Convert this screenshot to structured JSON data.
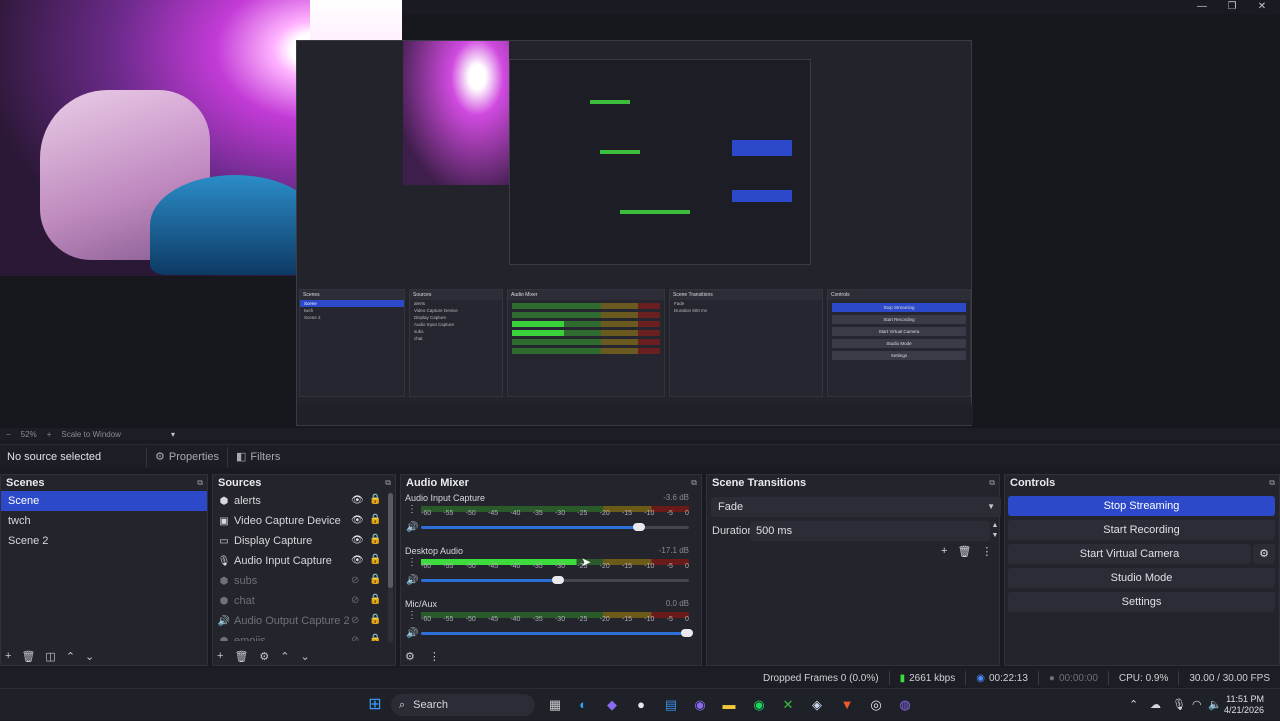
{
  "window": {
    "minimize": "—",
    "maximize": "❐",
    "close": "✕"
  },
  "zoom": {
    "percent": "52%",
    "plus": "+",
    "scale_mode": "Scale to Window",
    "dropdown": "▾"
  },
  "source_toolbar": {
    "no_source": "No source selected",
    "properties": "Properties",
    "filters": "Filters"
  },
  "scenes": {
    "title": "Scenes",
    "items": [
      {
        "label": "Scene",
        "selected": true
      },
      {
        "label": "twch",
        "selected": false
      },
      {
        "label": "Scene 2",
        "selected": false
      }
    ]
  },
  "sources": {
    "title": "Sources",
    "items": [
      {
        "label": "alerts",
        "icon": "⬢",
        "visible": true
      },
      {
        "label": "Video Capture Device",
        "icon": "▣",
        "visible": true
      },
      {
        "label": "Display Capture",
        "icon": "▭",
        "visible": true
      },
      {
        "label": "Audio Input Capture",
        "icon": "🎙",
        "visible": true
      },
      {
        "label": "subs",
        "icon": "⬢",
        "visible": false
      },
      {
        "label": "chat",
        "icon": "⬢",
        "visible": false
      },
      {
        "label": "Audio Output Capture 2",
        "icon": "🔊",
        "visible": false
      },
      {
        "label": "emojis",
        "icon": "⬢",
        "visible": false
      }
    ]
  },
  "mixer": {
    "title": "Audio Mixer",
    "ticks": [
      "-60",
      "-55",
      "-50",
      "-45",
      "-40",
      "-35",
      "-30",
      "-25",
      "-20",
      "-15",
      "-10",
      "-5",
      "0"
    ],
    "channels": [
      {
        "name": "Audio Input Capture",
        "db": "-3.6 dB",
        "level": 0.0,
        "volume": 0.82
      },
      {
        "name": "Desktop Audio",
        "db": "-17.1 dB",
        "level": 0.58,
        "volume": 0.52
      },
      {
        "name": "Mic/Aux",
        "db": "0.0 dB",
        "level": 0.0,
        "volume": 1.0
      }
    ]
  },
  "transitions": {
    "title": "Scene Transitions",
    "selected": "Fade",
    "duration_label": "Duration",
    "duration_value": "500 ms"
  },
  "controls": {
    "title": "Controls",
    "buttons": {
      "stop_streaming": "Stop Streaming",
      "start_recording": "Start Recording",
      "start_virtual_camera": "Start Virtual Camera",
      "studio_mode": "Studio Mode",
      "settings": "Settings"
    }
  },
  "status": {
    "dropped_frames": "Dropped Frames 0 (0.0%)",
    "bitrate": "2661 kbps",
    "stream_time": "00:22:13",
    "record_time": "00:00:00",
    "cpu": "CPU: 0.9%",
    "fps": "30.00 / 30.00 FPS"
  },
  "taskbar": {
    "search_placeholder": "Search",
    "time": "11:51 PM",
    "date": "4/21/2026"
  },
  "colors": {
    "accent": "#2c49c9",
    "meter_green": "#3ddc3d",
    "background": "#1a1b22"
  }
}
